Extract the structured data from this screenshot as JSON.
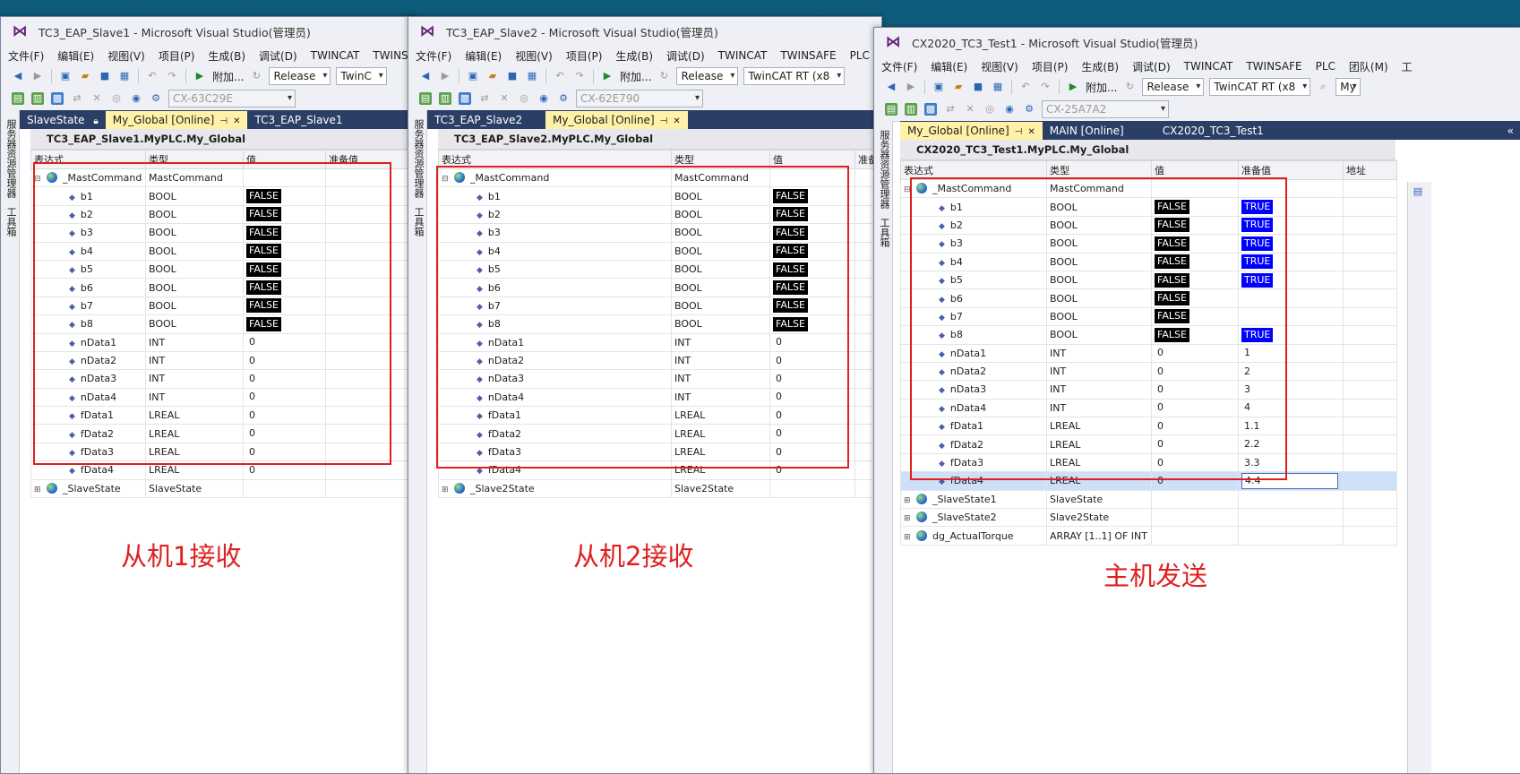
{
  "windows": [
    {
      "id": "slave1",
      "title": "TC3_EAP_Slave1 - Microsoft Visual Studio(管理员)",
      "menu": [
        "文件(F)",
        "编辑(E)",
        "视图(V)",
        "项目(P)",
        "生成(B)",
        "调试(D)",
        "TWINCAT",
        "TWINSA"
      ],
      "toolbar": {
        "attach": "附加...",
        "config": "Release",
        "platform": "TwinC",
        "target": "CX-63C29E"
      },
      "side_tabs": [
        "服务器资源管理器",
        "工具箱"
      ],
      "tabs": [
        "SlaveState",
        "My_Global [Online]",
        "TC3_EAP_Slave1"
      ],
      "watch_title": "TC3_EAP_Slave1.MyPLC.My_Global",
      "columns": [
        "表达式",
        "类型",
        "值",
        "准备值"
      ],
      "root": {
        "name": "_MastCommand",
        "type": "MastCommand"
      },
      "rows": [
        {
          "name": "b1",
          "type": "BOOL",
          "value": "FALSE",
          "prep": ""
        },
        {
          "name": "b2",
          "type": "BOOL",
          "value": "FALSE",
          "prep": ""
        },
        {
          "name": "b3",
          "type": "BOOL",
          "value": "FALSE",
          "prep": ""
        },
        {
          "name": "b4",
          "type": "BOOL",
          "value": "FALSE",
          "prep": ""
        },
        {
          "name": "b5",
          "type": "BOOL",
          "value": "FALSE",
          "prep": ""
        },
        {
          "name": "b6",
          "type": "BOOL",
          "value": "FALSE",
          "prep": ""
        },
        {
          "name": "b7",
          "type": "BOOL",
          "value": "FALSE",
          "prep": ""
        },
        {
          "name": "b8",
          "type": "BOOL",
          "value": "FALSE",
          "prep": ""
        },
        {
          "name": "nData1",
          "type": "INT",
          "value": "0",
          "prep": ""
        },
        {
          "name": "nData2",
          "type": "INT",
          "value": "0",
          "prep": ""
        },
        {
          "name": "nData3",
          "type": "INT",
          "value": "0",
          "prep": ""
        },
        {
          "name": "nData4",
          "type": "INT",
          "value": "0",
          "prep": ""
        },
        {
          "name": "fData1",
          "type": "LREAL",
          "value": "0",
          "prep": ""
        },
        {
          "name": "fData2",
          "type": "LREAL",
          "value": "0",
          "prep": ""
        },
        {
          "name": "fData3",
          "type": "LREAL",
          "value": "0",
          "prep": ""
        },
        {
          "name": "fData4",
          "type": "LREAL",
          "value": "0",
          "prep": ""
        }
      ],
      "extra": [
        {
          "name": "_SlaveState",
          "type": "SlaveState"
        }
      ],
      "caption": "从机1接收"
    },
    {
      "id": "slave2",
      "title": "TC3_EAP_Slave2 - Microsoft Visual Studio(管理员)",
      "menu": [
        "文件(F)",
        "编辑(E)",
        "视图(V)",
        "项目(P)",
        "生成(B)",
        "调试(D)",
        "TWINCAT",
        "TWINSAFE",
        "PLC"
      ],
      "toolbar": {
        "attach": "附加...",
        "config": "Release",
        "platform": "TwinCAT RT (x8",
        "target": "CX-62E790"
      },
      "side_tabs": [
        "服务器资源管理器",
        "工具箱"
      ],
      "tabs": [
        "TC3_EAP_Slave2",
        "My_Global [Online]"
      ],
      "watch_title": "TC3_EAP_Slave2.MyPLC.My_Global",
      "columns": [
        "表达式",
        "类型",
        "值",
        "准备"
      ],
      "root": {
        "name": "_MastCommand",
        "type": "MastCommand"
      },
      "rows": [
        {
          "name": "b1",
          "type": "BOOL",
          "value": "FALSE",
          "prep": ""
        },
        {
          "name": "b2",
          "type": "BOOL",
          "value": "FALSE",
          "prep": ""
        },
        {
          "name": "b3",
          "type": "BOOL",
          "value": "FALSE",
          "prep": ""
        },
        {
          "name": "b4",
          "type": "BOOL",
          "value": "FALSE",
          "prep": ""
        },
        {
          "name": "b5",
          "type": "BOOL",
          "value": "FALSE",
          "prep": ""
        },
        {
          "name": "b6",
          "type": "BOOL",
          "value": "FALSE",
          "prep": ""
        },
        {
          "name": "b7",
          "type": "BOOL",
          "value": "FALSE",
          "prep": ""
        },
        {
          "name": "b8",
          "type": "BOOL",
          "value": "FALSE",
          "prep": ""
        },
        {
          "name": "nData1",
          "type": "INT",
          "value": "0",
          "prep": ""
        },
        {
          "name": "nData2",
          "type": "INT",
          "value": "0",
          "prep": ""
        },
        {
          "name": "nData3",
          "type": "INT",
          "value": "0",
          "prep": ""
        },
        {
          "name": "nData4",
          "type": "INT",
          "value": "0",
          "prep": ""
        },
        {
          "name": "fData1",
          "type": "LREAL",
          "value": "0",
          "prep": ""
        },
        {
          "name": "fData2",
          "type": "LREAL",
          "value": "0",
          "prep": ""
        },
        {
          "name": "fData3",
          "type": "LREAL",
          "value": "0",
          "prep": ""
        },
        {
          "name": "fData4",
          "type": "LREAL",
          "value": "0",
          "prep": ""
        }
      ],
      "extra": [
        {
          "name": "_Slave2State",
          "type": "Slave2State"
        }
      ],
      "caption": "从机2接收"
    },
    {
      "id": "master",
      "title": "CX2020_TC3_Test1 - Microsoft Visual Studio(管理员)",
      "menu": [
        "文件(F)",
        "编辑(E)",
        "视图(V)",
        "项目(P)",
        "生成(B)",
        "调试(D)",
        "TWINCAT",
        "TWINSAFE",
        "PLC",
        "团队(M)",
        "工"
      ],
      "toolbar": {
        "attach": "附加...",
        "config": "Release",
        "platform": "TwinCAT RT (x8",
        "target": "CX-25A7A2",
        "extra": "My"
      },
      "side_tabs": [
        "服务器资源管理器",
        "工具箱"
      ],
      "tabs": [
        "My_Global [Online]",
        "MAIN [Online]",
        "CX2020_TC3_Test1"
      ],
      "tab_overflow": "«",
      "watch_title": "CX2020_TC3_Test1.MyPLC.My_Global",
      "columns": [
        "表达式",
        "类型",
        "值",
        "准备值",
        "地址"
      ],
      "root": {
        "name": "_MastCommand",
        "type": "MastCommand"
      },
      "rows": [
        {
          "name": "b1",
          "type": "BOOL",
          "value": "FALSE",
          "prep": "TRUE"
        },
        {
          "name": "b2",
          "type": "BOOL",
          "value": "FALSE",
          "prep": "TRUE"
        },
        {
          "name": "b3",
          "type": "BOOL",
          "value": "FALSE",
          "prep": "TRUE"
        },
        {
          "name": "b4",
          "type": "BOOL",
          "value": "FALSE",
          "prep": "TRUE"
        },
        {
          "name": "b5",
          "type": "BOOL",
          "value": "FALSE",
          "prep": "TRUE"
        },
        {
          "name": "b6",
          "type": "BOOL",
          "value": "FALSE",
          "prep": ""
        },
        {
          "name": "b7",
          "type": "BOOL",
          "value": "FALSE",
          "prep": ""
        },
        {
          "name": "b8",
          "type": "BOOL",
          "value": "FALSE",
          "prep": "TRUE"
        },
        {
          "name": "nData1",
          "type": "INT",
          "value": "0",
          "prep": "1"
        },
        {
          "name": "nData2",
          "type": "INT",
          "value": "0",
          "prep": "2"
        },
        {
          "name": "nData3",
          "type": "INT",
          "value": "0",
          "prep": "3"
        },
        {
          "name": "nData4",
          "type": "INT",
          "value": "0",
          "prep": "4"
        },
        {
          "name": "fData1",
          "type": "LREAL",
          "value": "0",
          "prep": "1.1"
        },
        {
          "name": "fData2",
          "type": "LREAL",
          "value": "0",
          "prep": "2.2"
        },
        {
          "name": "fData3",
          "type": "LREAL",
          "value": "0",
          "prep": "3.3"
        },
        {
          "name": "fData4",
          "type": "LREAL",
          "value": "0",
          "prep": "4.4"
        }
      ],
      "extra": [
        {
          "name": "_SlaveState1",
          "type": "SlaveState"
        },
        {
          "name": "_SlaveState2",
          "type": "Slave2State"
        },
        {
          "name": "dg_ActualTorque",
          "type": "ARRAY [1..1] OF INT"
        }
      ],
      "caption": "主机发送"
    }
  ],
  "colors": {
    "highlight_red": "#e02020",
    "false_bg": "#000000",
    "true_bg": "#0000ff",
    "tab_active": "#fff1a8",
    "tabbar": "#2b3f66"
  }
}
